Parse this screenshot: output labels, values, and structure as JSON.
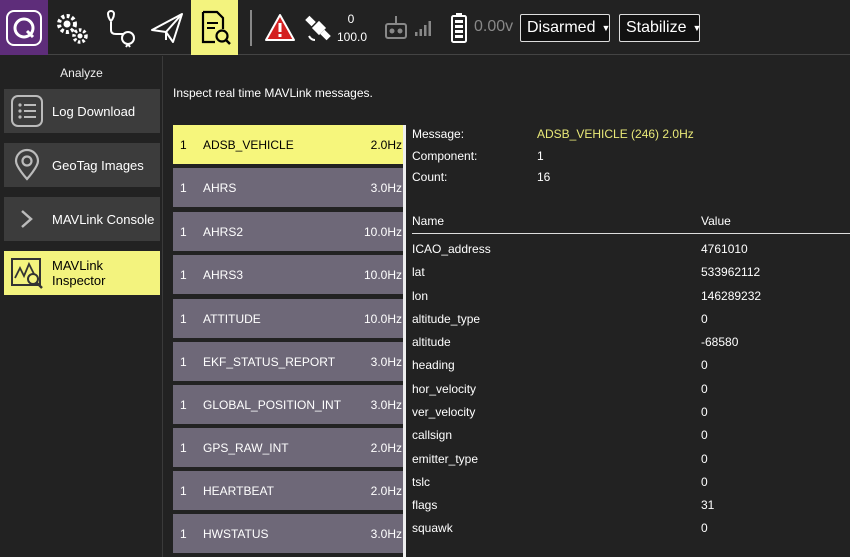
{
  "toolbar": {
    "gps_count": "0",
    "gps_hdop": "100.0",
    "voltage": "0.00v",
    "flight_status": "Disarmed",
    "flight_mode": "Stabilize"
  },
  "sidebar": {
    "title": "Analyze",
    "items": [
      {
        "label": "Log Download",
        "icon": "list-icon"
      },
      {
        "label": "GeoTag Images",
        "icon": "map-pin-icon"
      },
      {
        "label": "MAVLink Console",
        "icon": "chevron-right-icon"
      },
      {
        "label": "MAVLink Inspector",
        "icon": "chart-magnify-icon"
      }
    ]
  },
  "main": {
    "description": "Inspect real time MAVLink messages.",
    "messages": [
      {
        "comp": "1",
        "name": "ADSB_VEHICLE",
        "rate": "2.0Hz"
      },
      {
        "comp": "1",
        "name": "AHRS",
        "rate": "3.0Hz"
      },
      {
        "comp": "1",
        "name": "AHRS2",
        "rate": "10.0Hz"
      },
      {
        "comp": "1",
        "name": "AHRS3",
        "rate": "10.0Hz"
      },
      {
        "comp": "1",
        "name": "ATTITUDE",
        "rate": "10.0Hz"
      },
      {
        "comp": "1",
        "name": "EKF_STATUS_REPORT",
        "rate": "3.0Hz"
      },
      {
        "comp": "1",
        "name": "GLOBAL_POSITION_INT",
        "rate": "3.0Hz"
      },
      {
        "comp": "1",
        "name": "GPS_RAW_INT",
        "rate": "2.0Hz"
      },
      {
        "comp": "1",
        "name": "HEARTBEAT",
        "rate": "2.0Hz"
      },
      {
        "comp": "1",
        "name": "HWSTATUS",
        "rate": "3.0Hz"
      }
    ],
    "detail": {
      "message_label": "Message:",
      "message_value": "ADSB_VEHICLE (246) 2.0Hz",
      "component_label": "Component:",
      "component_value": "1",
      "count_label": "Count:",
      "count_value": "16",
      "name_header": "Name",
      "value_header": "Value",
      "fields": [
        {
          "name": "ICAO_address",
          "value": "4761010"
        },
        {
          "name": "lat",
          "value": "533962112"
        },
        {
          "name": "lon",
          "value": "146289232"
        },
        {
          "name": "altitude_type",
          "value": "0"
        },
        {
          "name": "altitude",
          "value": "-68580"
        },
        {
          "name": "heading",
          "value": "0"
        },
        {
          "name": "hor_velocity",
          "value": "0"
        },
        {
          "name": "ver_velocity",
          "value": "0"
        },
        {
          "name": "callsign",
          "value": "0"
        },
        {
          "name": "emitter_type",
          "value": "0"
        },
        {
          "name": "tslc",
          "value": "0"
        },
        {
          "name": "flags",
          "value": "31"
        },
        {
          "name": "squawk",
          "value": "0"
        }
      ]
    }
  },
  "colors": {
    "accent_yellow": "#f3f37e",
    "logo_purple": "#5e2d7a",
    "list_item_bg": "#6e6878",
    "warning_red": "#d42020"
  }
}
